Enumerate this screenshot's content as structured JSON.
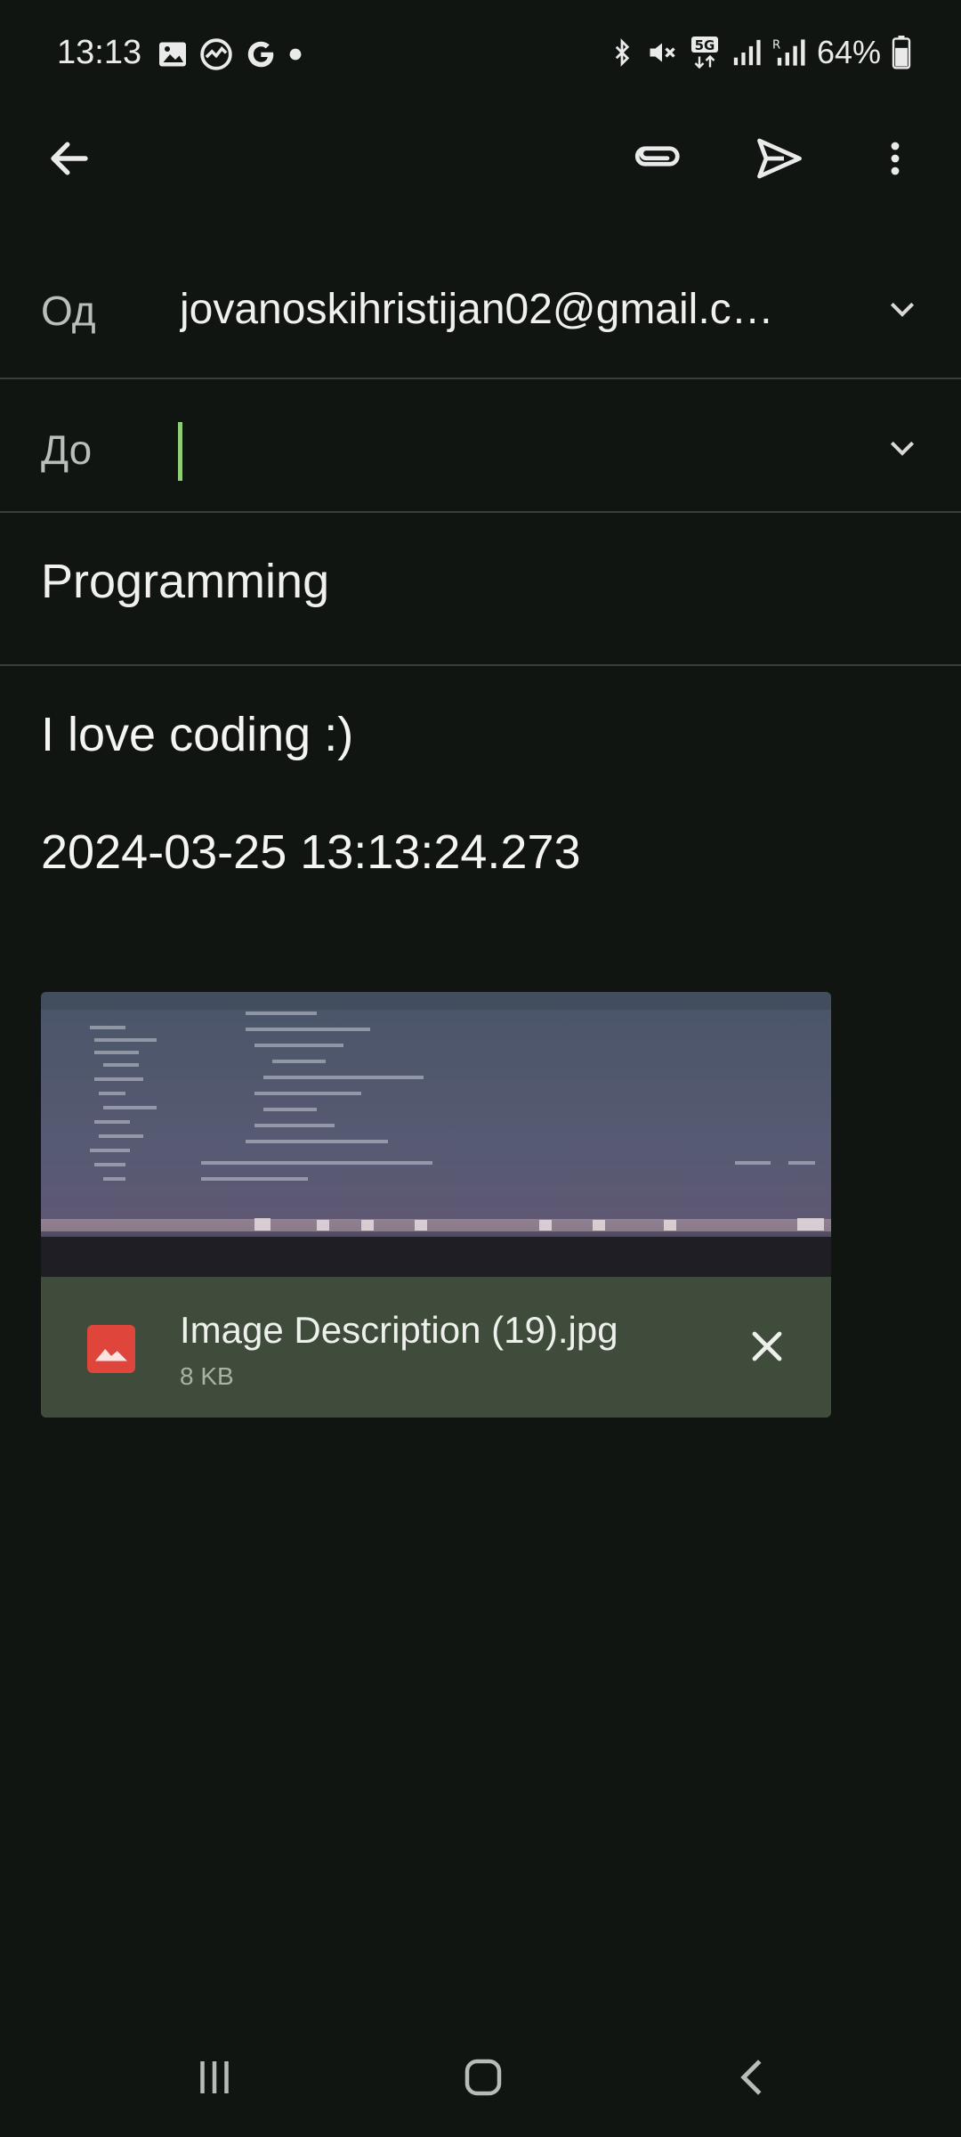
{
  "status_bar": {
    "time": "13:13",
    "battery_text": "64%",
    "left_icons": [
      "gallery-icon",
      "activity-icon",
      "google-icon",
      "dot-icon"
    ],
    "right_icons": [
      "bluetooth-icon",
      "mute-icon",
      "5g-icon",
      "signal-icon",
      "signal-r-icon",
      "battery-icon"
    ]
  },
  "toolbar": {
    "back_icon": "arrow-left-icon",
    "attach_icon": "paperclip-icon",
    "send_icon": "send-icon",
    "more_icon": "more-vert-icon"
  },
  "compose": {
    "from_label": "Од",
    "from_value": "jovanoskihristijan02@gmail.c…",
    "to_label": "До",
    "to_value": "",
    "subject": "Programming",
    "body_lines": [
      "I love coding :)",
      "2024-03-25 13:13:24.273"
    ]
  },
  "attachment": {
    "name": "Image Description (19).jpg",
    "size": "8 KB",
    "icon": "image-file-icon",
    "close_icon": "close-icon"
  },
  "colors": {
    "background": "#111512",
    "divider": "#3a3f3b",
    "caret": "#8fce72",
    "attachment_bg": "#3f4b3b",
    "file_icon": "#e0453c"
  },
  "nav_bar": {
    "recents_icon": "recents-icon",
    "home_icon": "home-icon",
    "back_icon": "nav-back-icon"
  }
}
